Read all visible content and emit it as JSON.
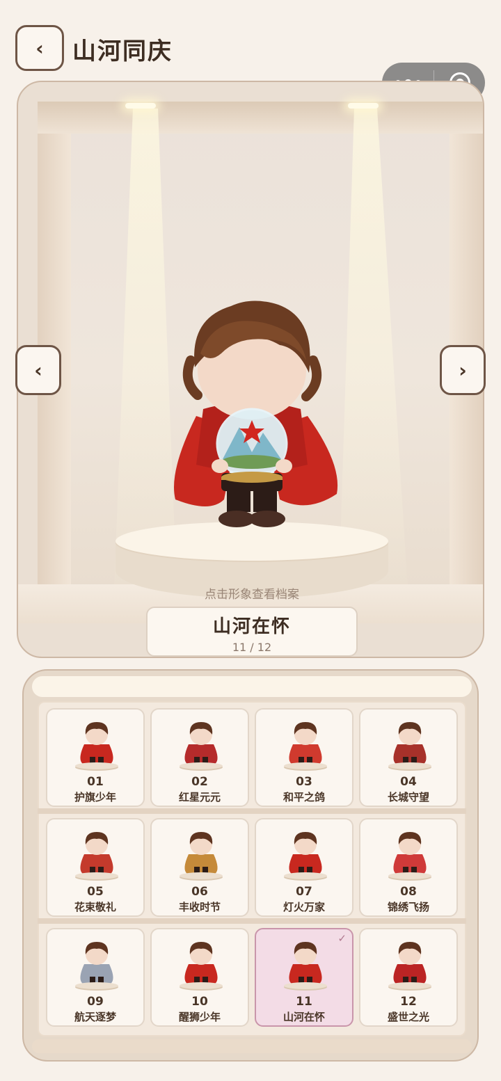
{
  "header": {
    "title": "山河同庆"
  },
  "showcase": {
    "hint": "点击形象查看档案",
    "current": {
      "name": "山河在怀",
      "index": "11 / 12"
    }
  },
  "colors": {
    "accent_selected": "#f3dce6",
    "cape_red": "#c8281f",
    "brand_brown": "#6e5546"
  },
  "collection": {
    "items": [
      {
        "num": "01",
        "label": "护旗少年",
        "selected": false
      },
      {
        "num": "02",
        "label": "红星元元",
        "selected": false
      },
      {
        "num": "03",
        "label": "和平之鸽",
        "selected": false
      },
      {
        "num": "04",
        "label": "长城守望",
        "selected": false
      },
      {
        "num": "05",
        "label": "花束敬礼",
        "selected": false
      },
      {
        "num": "06",
        "label": "丰收时节",
        "selected": false
      },
      {
        "num": "07",
        "label": "灯火万家",
        "selected": false
      },
      {
        "num": "08",
        "label": "锦绣飞扬",
        "selected": false
      },
      {
        "num": "09",
        "label": "航天逐梦",
        "selected": false
      },
      {
        "num": "10",
        "label": "醒狮少年",
        "selected": false
      },
      {
        "num": "11",
        "label": "山河在怀",
        "selected": true,
        "check": "✓"
      },
      {
        "num": "12",
        "label": "盛世之光",
        "selected": false
      }
    ]
  },
  "icons": {
    "back": "‹",
    "prev": "‹",
    "next": "›"
  }
}
